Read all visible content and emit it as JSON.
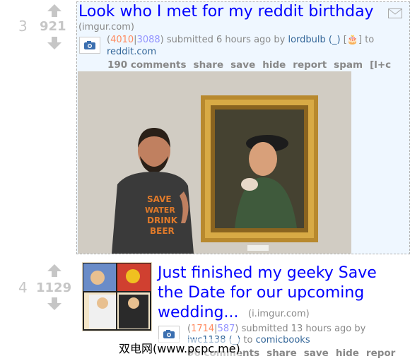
{
  "posts": [
    {
      "rank": "3",
      "score": "921",
      "title": "Look who I met for my reddit birthday",
      "domain": "(imgur.com)",
      "up_votes": "4010",
      "down_votes": "3088",
      "submitted": "submitted 6 hours ago by",
      "author": "lordbulb",
      "flair": "(_)",
      "trophy": "[🎂]",
      "to": "to",
      "subreddit": "reddit.com",
      "buttons": [
        "190 comments",
        "share",
        "save",
        "hide",
        "report",
        "spam",
        "[l+c"
      ]
    },
    {
      "rank": "4",
      "score": "1129",
      "title_line1": "Just finished my geeky Save",
      "title_line2": "the Date for our upcoming",
      "title_line3": "wedding...",
      "domain": "(i.imgur.com)",
      "up_votes": "1714",
      "down_votes": "587",
      "submitted": "submitted 13 hours ago by",
      "author": "iwc1138",
      "flair": "(_)",
      "to": "to",
      "subreddit": "comicbooks",
      "buttons": [
        "96 comments",
        "share",
        "save",
        "hide",
        "repor"
      ]
    }
  ],
  "watermark": "双电网(www.pcpc.me)",
  "colors": {
    "upvote": "#ff8b60",
    "downvote": "#9494ff",
    "title": "#0000ff",
    "link": "#336699"
  }
}
